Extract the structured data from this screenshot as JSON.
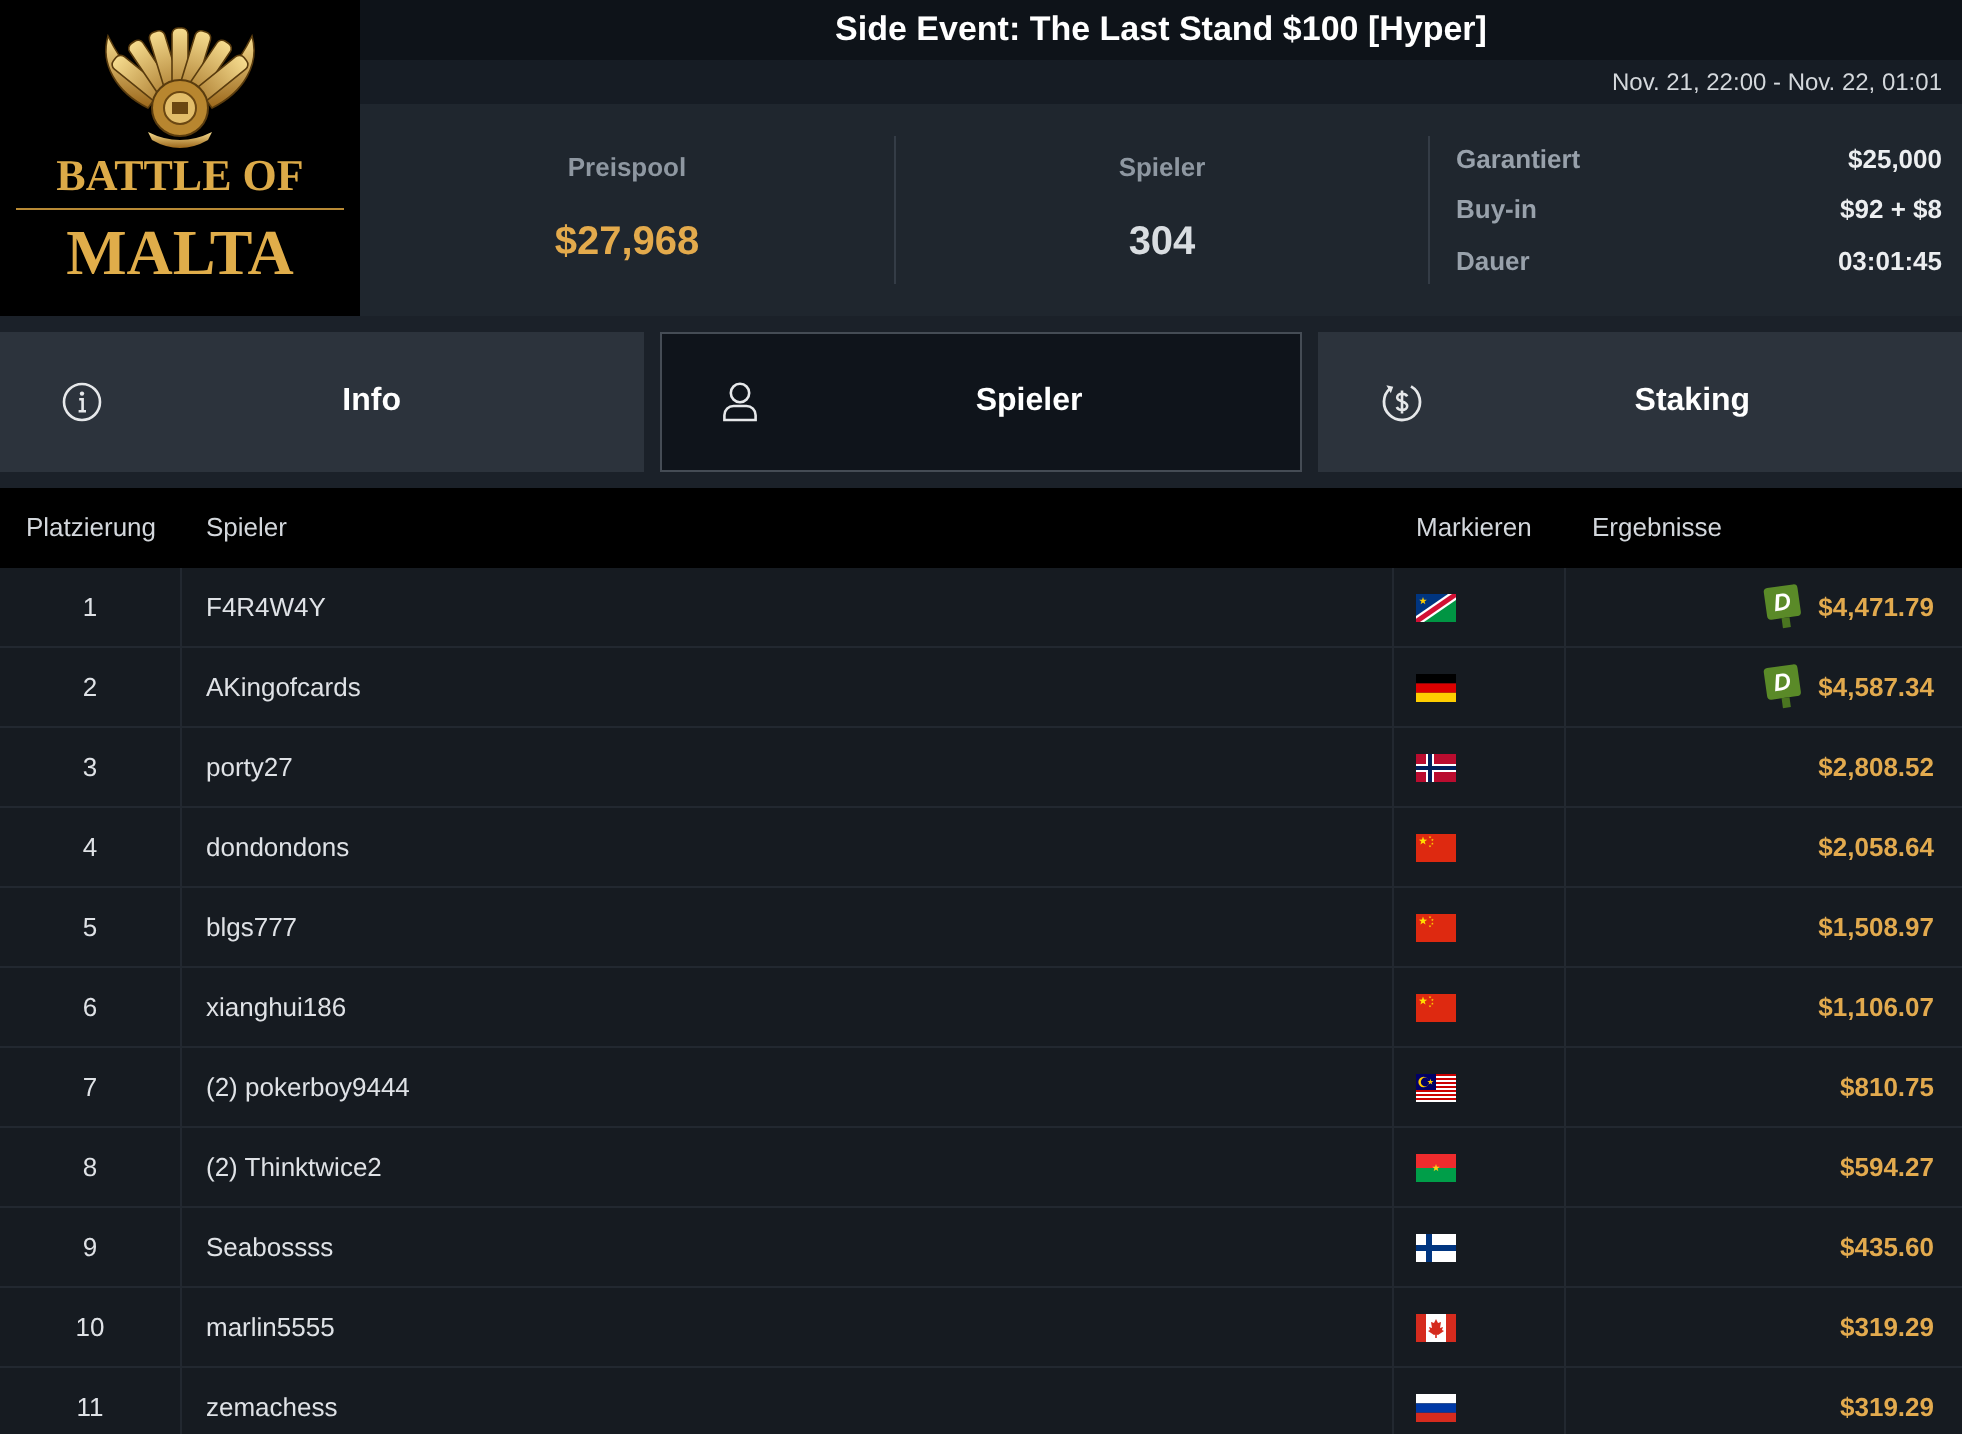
{
  "logo": {
    "lines": [
      "BATTLE OF",
      "MALTA"
    ]
  },
  "title": "Side Event: The Last Stand $100 [Hyper]",
  "date_range": "Nov. 21, 22:00 - Nov. 22, 01:01",
  "stats": [
    {
      "kind": "prize",
      "label": "Preispool",
      "value": "$27,968"
    },
    {
      "kind": "count",
      "label": "Spieler",
      "value": "304"
    }
  ],
  "details": [
    {
      "label": "Garantiert",
      "value": "$25,000"
    },
    {
      "label": "Buy-in",
      "value": "$92 + $8"
    },
    {
      "label": "Dauer",
      "value": "03:01:45"
    }
  ],
  "tabs": [
    {
      "kind": "info",
      "label": "Info",
      "selected": false
    },
    {
      "kind": "players",
      "label": "Spieler",
      "selected": true
    },
    {
      "kind": "staking",
      "label": "Staking",
      "selected": false
    }
  ],
  "table": {
    "columns": [
      "Platzierung",
      "Spieler",
      "Markieren",
      "Ergebnisse"
    ],
    "rows": [
      {
        "place": "1",
        "player": "F4R4W4Y",
        "flag": {
          "kind": "na"
        },
        "badge": "D",
        "result": "$4,471.79"
      },
      {
        "place": "2",
        "player": "AKingofcards",
        "flag": {
          "kind": "de"
        },
        "badge": "D",
        "result": "$4,587.34"
      },
      {
        "place": "3",
        "player": "porty27",
        "flag": {
          "kind": "no"
        },
        "result": "$2,808.52"
      },
      {
        "place": "4",
        "player": "dondondons",
        "flag": {
          "kind": "cn"
        },
        "result": "$2,058.64"
      },
      {
        "place": "5",
        "player": "blgs777",
        "flag": {
          "kind": "cn"
        },
        "result": "$1,508.97"
      },
      {
        "place": "6",
        "player": "xianghui186",
        "flag": {
          "kind": "cn"
        },
        "result": "$1,106.07"
      },
      {
        "place": "7",
        "player": "(2) pokerboy9444",
        "flag": {
          "kind": "my"
        },
        "result": "$810.75"
      },
      {
        "place": "8",
        "player": "(2) Thinktwice2",
        "flag": {
          "kind": "bf"
        },
        "result": "$594.27"
      },
      {
        "place": "9",
        "player": "Seabossss",
        "flag": {
          "kind": "fi"
        },
        "result": "$435.60"
      },
      {
        "place": "10",
        "player": "marlin5555",
        "flag": {
          "kind": "ca"
        },
        "result": "$319.29"
      },
      {
        "place": "11",
        "player": "zemachess",
        "flag": {
          "kind": "ru"
        },
        "result": "$319.29"
      }
    ]
  }
}
